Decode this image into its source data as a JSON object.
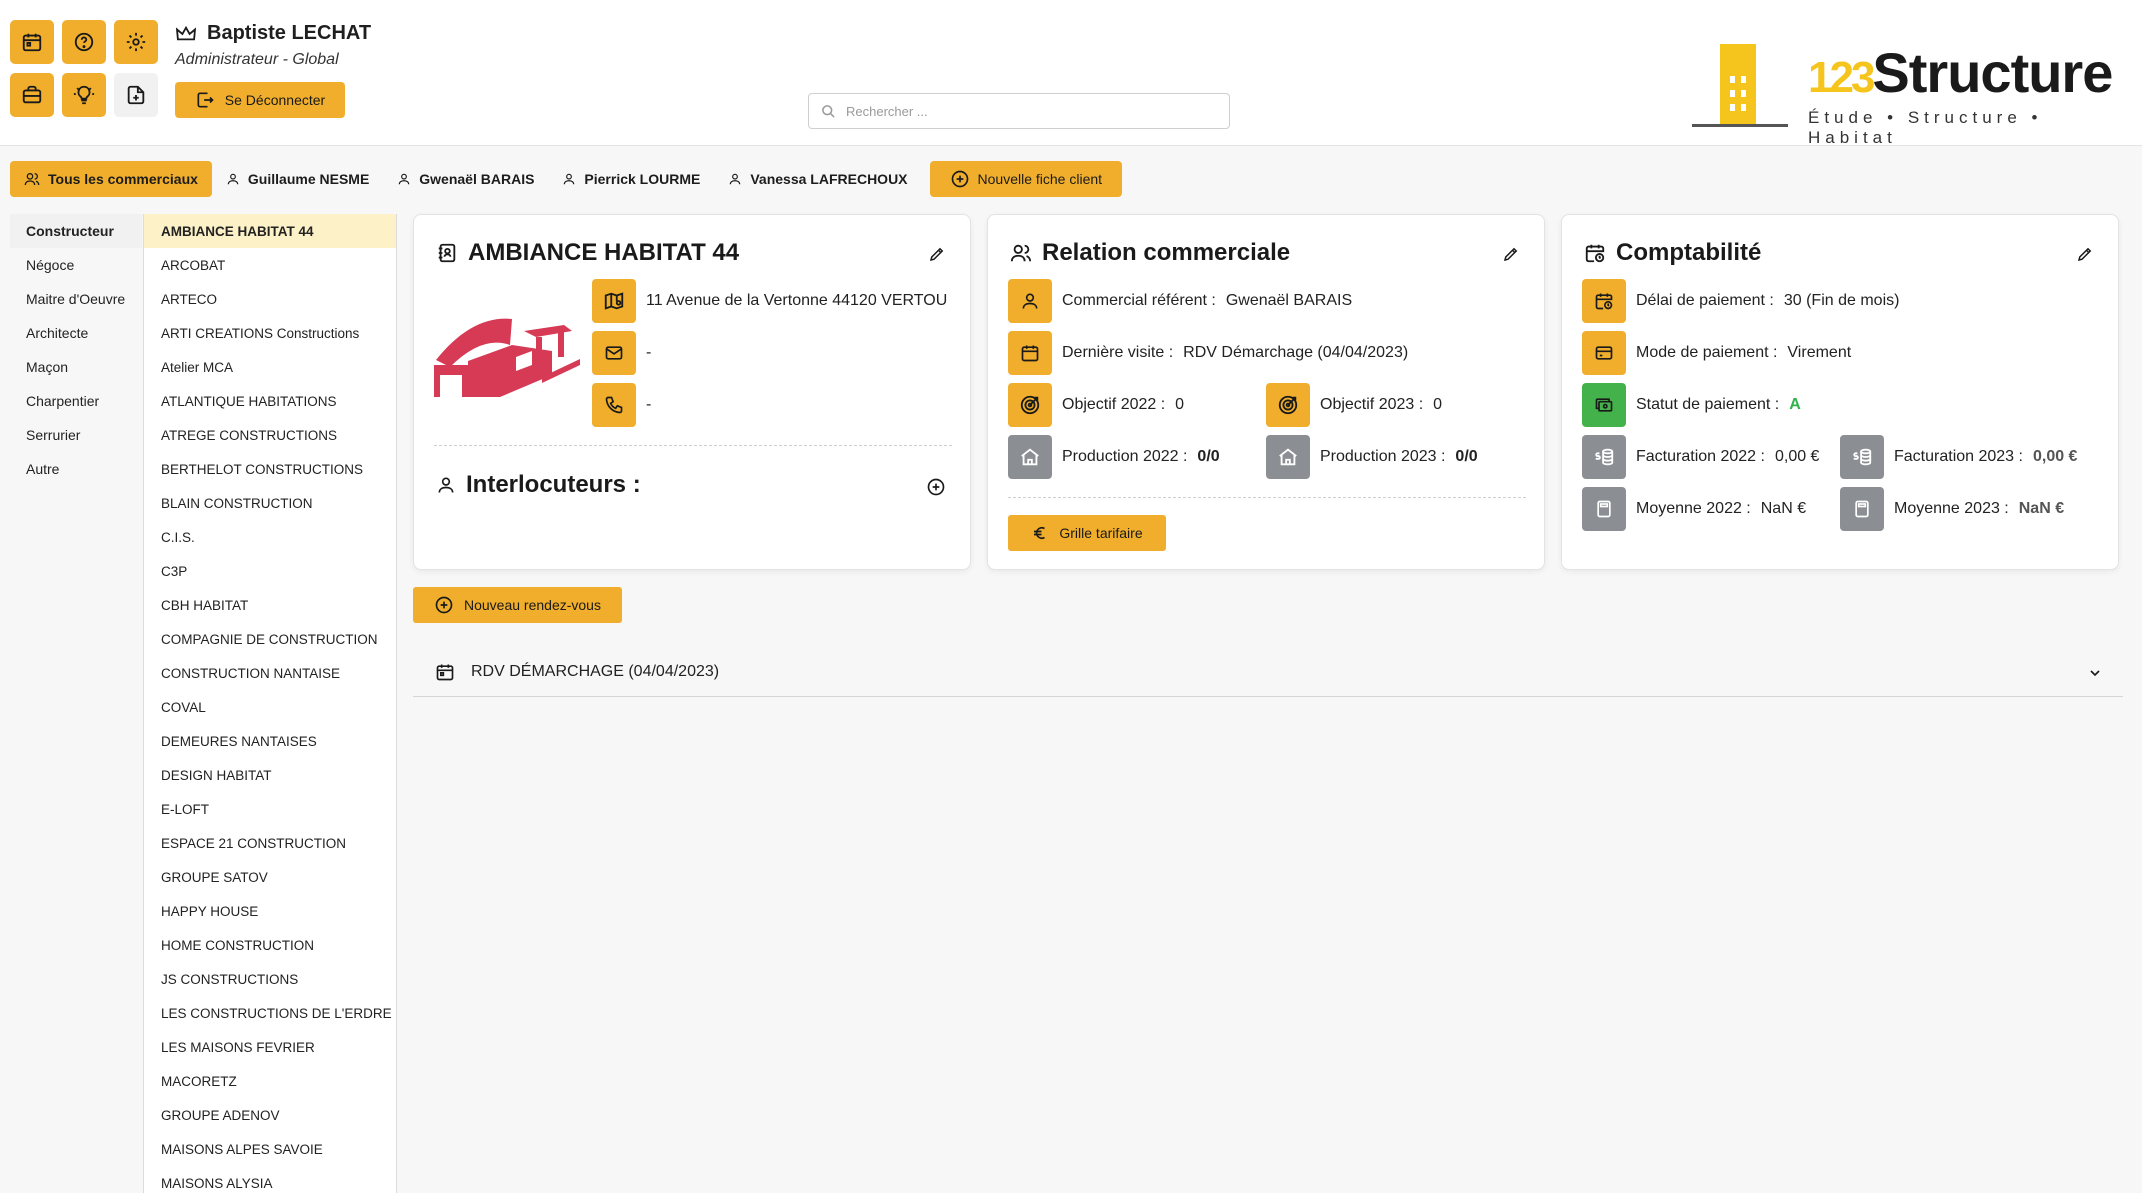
{
  "header": {
    "user_name": "Baptiste LECHAT",
    "user_role": "Administrateur - Global",
    "logout_label": "Se Déconnecter",
    "search_placeholder": "Rechercher ...",
    "logo_word": "Structure",
    "logo_number": "123",
    "logo_tagline": "Étude • Structure • Habitat",
    "icons": [
      "calendar-icon",
      "help-icon",
      "settings-icon",
      "briefcase-icon",
      "lightbulb-icon",
      "file-add-icon"
    ]
  },
  "tabs": {
    "all": "Tous les commerciaux",
    "commercials": [
      "Guillaume NESME",
      "Gwenaël BARAIS",
      "Pierrick LOURME",
      "Vanessa LAFRECHOUX"
    ],
    "new_client": "Nouvelle fiche client"
  },
  "categories": [
    "Constructeur",
    "Négoce",
    "Maitre d'Oeuvre",
    "Architecte",
    "Maçon",
    "Charpentier",
    "Serrurier",
    "Autre"
  ],
  "clients": [
    "AMBIANCE HABITAT 44",
    "ARCOBAT",
    "ARTECO",
    "ARTI CREATIONS Constructions",
    "Atelier MCA",
    "ATLANTIQUE HABITATIONS",
    "ATREGE CONSTRUCTIONS",
    "BERTHELOT CONSTRUCTIONS",
    "BLAIN CONSTRUCTION",
    "C.I.S.",
    "C3P",
    "CBH HABITAT",
    "COMPAGNIE DE CONSTRUCTION",
    "CONSTRUCTION NANTAISE",
    "COVAL",
    "DEMEURES NANTAISES",
    "DESIGN HABITAT",
    "E-LOFT",
    "ESPACE 21 CONSTRUCTION",
    "GROUPE SATOV",
    "HAPPY HOUSE",
    "HOME CONSTRUCTION",
    "JS CONSTRUCTIONS",
    "LES CONSTRUCTIONS DE L'ERDRE",
    "LES MAISONS FEVRIER",
    "MACORETZ",
    "GROUPE ADENOV",
    "MAISONS ALPES SAVOIE",
    "MAISONS ALYSIA"
  ],
  "client_card": {
    "title": "AMBIANCE HABITAT 44",
    "address": "11 Avenue de la Vertonne 44120 VERTOU",
    "email": "-",
    "phone": "-",
    "interlocutors_title": "Interlocuteurs :"
  },
  "relation_card": {
    "title": "Relation commerciale",
    "referent_label": "Commercial référent :",
    "referent_value": "Gwenaël BARAIS",
    "last_visit_label": "Dernière visite :",
    "last_visit_value": "RDV Démarchage (04/04/2023)",
    "objective_2022_label": "Objectif 2022 :",
    "objective_2022_value": "0",
    "objective_2023_label": "Objectif 2023 :",
    "objective_2023_value": "0",
    "production_2022_label": "Production 2022 :",
    "production_2022_value": "0/0",
    "production_2023_label": "Production 2023 :",
    "production_2023_value": "0/0",
    "grille_label": "Grille tarifaire"
  },
  "compta_card": {
    "title": "Comptabilité",
    "delay_label": "Délai de paiement :",
    "delay_value": "30 (Fin de mois)",
    "mode_label": "Mode de paiement :",
    "mode_value": "Virement",
    "status_label": "Statut de paiement :",
    "status_value": "A",
    "billing_2022_label": "Facturation 2022 :",
    "billing_2022_value": "0,00 €",
    "billing_2023_label": "Facturation 2023 :",
    "billing_2023_value": "0,00 €",
    "average_2022_label": "Moyenne 2022 :",
    "average_2022_value": "NaN €",
    "average_2023_label": "Moyenne 2023 :",
    "average_2023_value": "NaN €"
  },
  "appointments": {
    "new_label": "Nouveau rendez-vous",
    "items": [
      "RDV DÉMARCHAGE (04/04/2023)"
    ]
  },
  "colors": {
    "accent": "#f0ae2c",
    "status_green": "#43b24a",
    "muted_icon": "#8b8f94",
    "logo_red": "#d63a55",
    "selected_client": "#fdf1c8"
  }
}
